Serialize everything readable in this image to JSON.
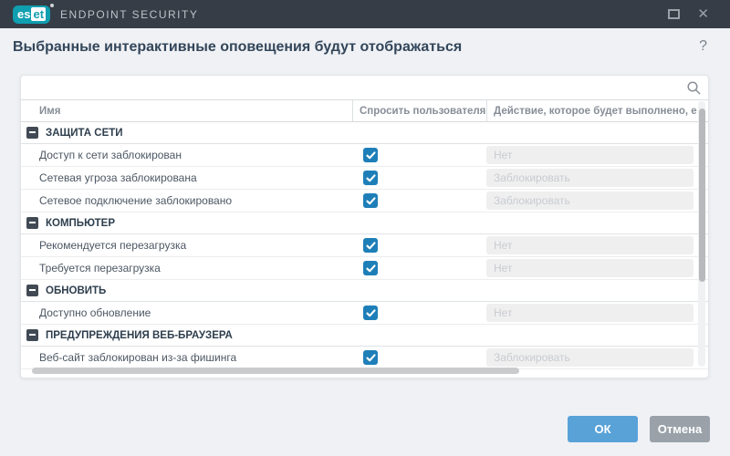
{
  "titlebar": {
    "logo_left": "es",
    "logo_right": "et",
    "product": "ENDPOINT SECURITY",
    "close_glyph": "✕"
  },
  "header": {
    "title": "Выбранные интерактивные оповещения будут отображаться",
    "help_glyph": "?"
  },
  "search": {
    "value": "",
    "placeholder": ""
  },
  "table": {
    "columns": [
      "Имя",
      "Спросить пользователя",
      "Действие, которое будет выполнено, е"
    ],
    "groups": [
      {
        "label": "ЗАЩИТА СЕТИ",
        "items": [
          {
            "name": "Доступ к сети заблокирован",
            "ask_user": true,
            "action": "Нет"
          },
          {
            "name": "Сетевая угроза заблокирована",
            "ask_user": true,
            "action": "Заблокировать"
          },
          {
            "name": "Сетевое подключение заблокировано",
            "ask_user": true,
            "action": "Заблокировать"
          }
        ]
      },
      {
        "label": "КОМПЬЮТЕР",
        "items": [
          {
            "name": "Рекомендуется перезагрузка",
            "ask_user": true,
            "action": "Нет"
          },
          {
            "name": "Требуется перезагрузка",
            "ask_user": true,
            "action": "Нет"
          }
        ]
      },
      {
        "label": "ОБНОВИТЬ",
        "items": [
          {
            "name": "Доступно обновление",
            "ask_user": true,
            "action": "Нет"
          }
        ]
      },
      {
        "label": "ПРЕДУПРЕЖДЕНИЯ ВЕБ-БРАУЗЕРА",
        "items": [
          {
            "name": "Веб-сайт заблокирован из-за фишинга",
            "ask_user": true,
            "action": "Заблокировать"
          }
        ]
      }
    ]
  },
  "footer": {
    "ok": "ОК",
    "cancel": "Отмена"
  },
  "icons": {
    "search": "magnifier",
    "collapse": "minus",
    "maximize": "square",
    "checkbox": "checkmark"
  },
  "colors": {
    "titlebar_bg": "#363d46",
    "brand_teal": "#0f9fb0",
    "checkbox_blue": "#1e7fb8",
    "ok_button": "#58a2d8",
    "cancel_button": "#9aa1a9",
    "page_bg": "#eff1f5"
  }
}
